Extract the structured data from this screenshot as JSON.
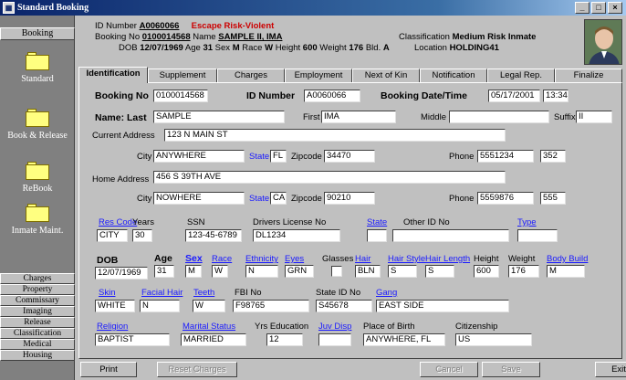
{
  "window": {
    "title": "Standard Booking",
    "minimize": "_",
    "maximize": "□",
    "close": "×"
  },
  "sidebar": {
    "top_tab": "Booking",
    "items": [
      {
        "label": "Standard"
      },
      {
        "label": "Book & Release"
      },
      {
        "label": "ReBook"
      },
      {
        "label": "Inmate Maint."
      }
    ],
    "buttons": [
      "Charges",
      "Property",
      "Commissary",
      "Imaging",
      "Release",
      "Classification",
      "Medical",
      "Housing"
    ]
  },
  "header": {
    "id_label": "ID Number",
    "id_value": "A0060066",
    "alert": "Escape Risk-Violent",
    "booking_label": "Booking No",
    "booking_value": "0100014568",
    "name_label": "Name",
    "name_value": "SAMPLE II, IMA",
    "dob_label": "DOB",
    "dob_value": "12/07/1969",
    "age_label": "Age",
    "age_value": "31",
    "sex_label": "Sex",
    "sex_value": "M",
    "race_label": "Race",
    "race_value": "W",
    "height_label": "Height",
    "height_value": "600",
    "weight_label": "Weight",
    "weight_value": "176",
    "bld_label": "Bld.",
    "bld_value": "A",
    "class_label": "Classification",
    "class_value": "Medium Risk Inmate",
    "location_label": "Location",
    "location_value": "HOLDING41"
  },
  "tabs": [
    "Identification",
    "Supplement",
    "Charges",
    "Employment",
    "Next of Kin",
    "Notification",
    "Legal Rep.",
    "Finalize"
  ],
  "form": {
    "booking_no_label": "Booking No",
    "booking_no": "0100014568",
    "id_number_label": "ID Number",
    "id_number": "A0060066",
    "booking_dt_label": "Booking Date/Time",
    "booking_date": "05/17/2001",
    "booking_time": "13:34",
    "name_last_label": "Name: Last",
    "last": "SAMPLE",
    "first_label": "First",
    "first": "IMA",
    "middle_label": "Middle",
    "middle": "",
    "suffix_label": "Suffix",
    "suffix": "II",
    "current_addr_label": "Current Address",
    "current_addr": "123 N MAIN ST",
    "city_label": "City",
    "city1": "ANYWHERE",
    "state_label": "State",
    "state1": "FL",
    "zip_label": "Zipcode",
    "zip1": "34470",
    "phone_label": "Phone",
    "phone1": "5551234",
    "ext1": "352",
    "home_addr_label": "Home Address",
    "home_addr": "456 S 39TH AVE",
    "city2": "NOWHERE",
    "state2": "CA",
    "zip2": "90210",
    "phone2": "5559876",
    "ext2": "555",
    "res_code_label": "Res Code",
    "res_code": "CITY",
    "years_label": "Years",
    "years": "30",
    "ssn_label": "SSN",
    "ssn": "123-45-6789",
    "dl_label": "Drivers License No",
    "dl": "DL1234",
    "dl_state_label": "State",
    "dl_state": "",
    "other_id_label": "Other ID No",
    "other_id": "",
    "type_label": "Type",
    "type": "",
    "dob_label": "DOB",
    "dob": "12/07/1969",
    "age_label": "Age",
    "age": "31",
    "sex_label": "Sex",
    "sex": "M",
    "race_label": "Race",
    "race": "W",
    "ethnicity_label": "Ethnicity",
    "ethnicity": "N",
    "eyes_label": "Eyes",
    "eyes": "GRN",
    "glasses_label": "Glasses",
    "hair_label": "Hair",
    "hair": "BLN",
    "hair_style_label": "Hair Style",
    "hair_style": "S",
    "hair_length_label": "Hair Length",
    "hair_length": "S",
    "height_label": "Height",
    "height": "600",
    "weight_label": "Weight",
    "weight": "176",
    "body_build_label": "Body Build",
    "body_build": "M",
    "skin_label": "Skin",
    "skin": "WHITE",
    "facial_hair_label": "Facial Hair",
    "facial_hair": "N",
    "teeth_label": "Teeth",
    "teeth": "W",
    "fbi_label": "FBI No",
    "fbi": "F98765",
    "state_id_label": "State ID No",
    "state_id": "S45678",
    "gang_label": "Gang",
    "gang": "EAST SIDE",
    "religion_label": "Religion",
    "religion": "BAPTIST",
    "marital_label": "Marital Status",
    "marital": "MARRIED",
    "yrs_edu_label": "Yrs Education",
    "yrs_edu": "12",
    "juv_disp_label": "Juv Disp",
    "juv_disp": "",
    "pob_label": "Place of Birth",
    "pob": "ANYWHERE, FL",
    "citizenship_label": "Citizenship",
    "citizenship": "US"
  },
  "buttons": {
    "print": "Print",
    "reset": "Reset Charges",
    "cancel": "Cancel",
    "save": "Save",
    "exit": "Exit"
  }
}
